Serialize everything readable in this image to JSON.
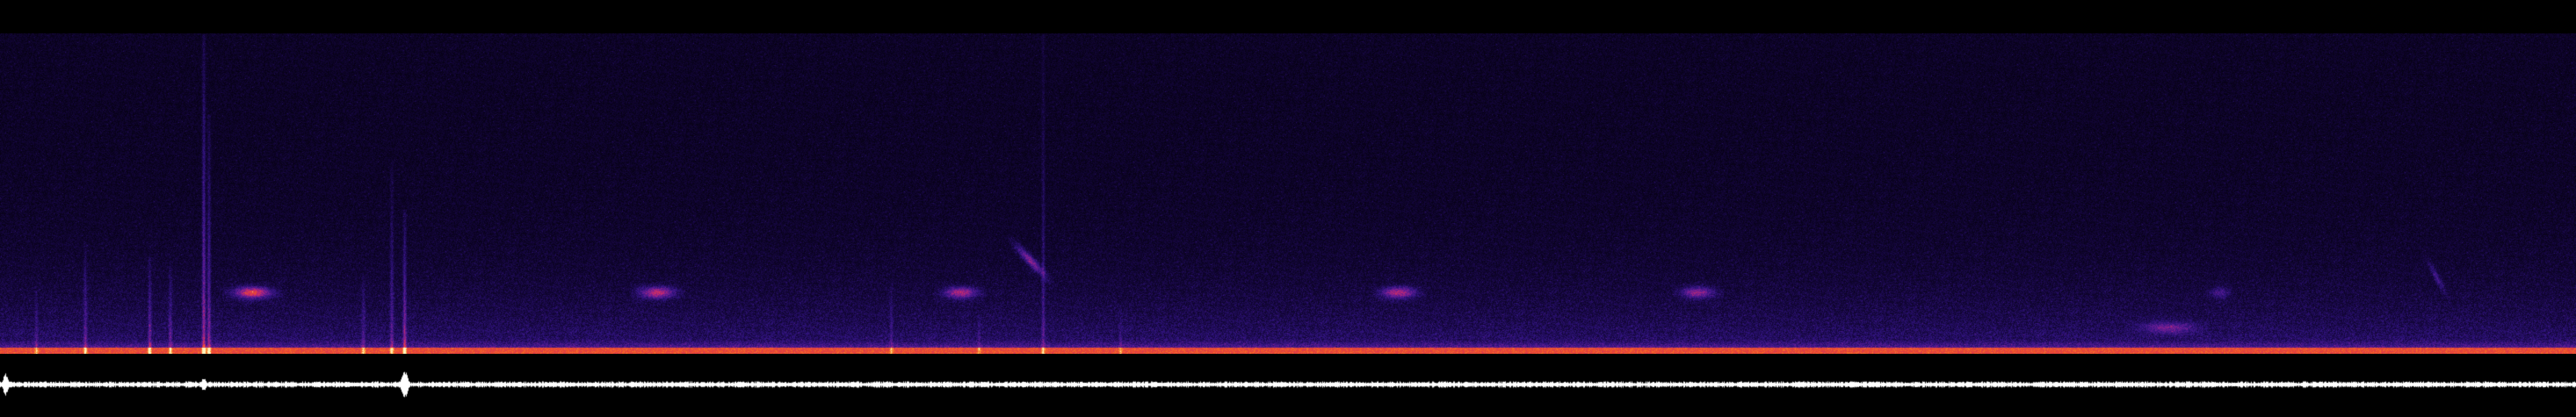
{
  "view": {
    "kind": "spectrogram-with-waveform",
    "colormap": "magma",
    "colors": {
      "background": "#000000",
      "spectrogram_low": "#03000a",
      "spectrogram_mid": "#3a1a8c",
      "spectrogram_high": "#e83a2a",
      "spectrogram_peak": "#fff2b0",
      "waveform": "#ffffff"
    }
  },
  "signal": {
    "calls": [
      {
        "t": 0.098,
        "f": 0.19,
        "dur": 0.018,
        "intensity": 0.95,
        "shape": "flat"
      },
      {
        "t": 0.255,
        "f": 0.19,
        "dur": 0.017,
        "intensity": 0.8,
        "shape": "flat"
      },
      {
        "t": 0.373,
        "f": 0.19,
        "dur": 0.016,
        "intensity": 0.75,
        "shape": "flat"
      },
      {
        "t": 0.4,
        "f": 0.29,
        "dur": 0.014,
        "intensity": 0.65,
        "shape": "down-sweep"
      },
      {
        "t": 0.543,
        "f": 0.19,
        "dur": 0.017,
        "intensity": 0.75,
        "shape": "flat"
      },
      {
        "t": 0.659,
        "f": 0.19,
        "dur": 0.016,
        "intensity": 0.65,
        "shape": "flat"
      },
      {
        "t": 0.842,
        "f": 0.08,
        "dur": 0.025,
        "intensity": 0.45,
        "shape": "flat"
      },
      {
        "t": 0.862,
        "f": 0.19,
        "dur": 0.01,
        "intensity": 0.35,
        "shape": "flat"
      },
      {
        "t": 0.946,
        "f": 0.24,
        "dur": 0.008,
        "intensity": 0.35,
        "shape": "down-sweep"
      }
    ],
    "transients": [
      {
        "t": 0.079,
        "intensity": 1.0,
        "reach": 1.0
      },
      {
        "t": 0.081,
        "intensity": 0.8,
        "reach": 0.75
      },
      {
        "t": 0.157,
        "intensity": 0.9,
        "reach": 0.45
      },
      {
        "t": 0.152,
        "intensity": 0.6,
        "reach": 0.6
      },
      {
        "t": 0.405,
        "intensity": 0.5,
        "reach": 1.0
      },
      {
        "t": 0.033,
        "intensity": 0.6,
        "reach": 0.35
      },
      {
        "t": 0.058,
        "intensity": 0.7,
        "reach": 0.3
      },
      {
        "t": 0.066,
        "intensity": 0.6,
        "reach": 0.28
      },
      {
        "t": 0.014,
        "intensity": 0.4,
        "reach": 0.2
      },
      {
        "t": 0.141,
        "intensity": 0.5,
        "reach": 0.25
      },
      {
        "t": 0.346,
        "intensity": 0.4,
        "reach": 0.22
      },
      {
        "t": 0.38,
        "intensity": 0.35,
        "reach": 0.12
      },
      {
        "t": 0.435,
        "intensity": 0.3,
        "reach": 0.15
      }
    ],
    "waveform_spikes": [
      {
        "t": 0.002,
        "amp": 0.55
      },
      {
        "t": 0.157,
        "amp": 0.85
      },
      {
        "t": 0.079,
        "amp": 0.35
      }
    ]
  }
}
